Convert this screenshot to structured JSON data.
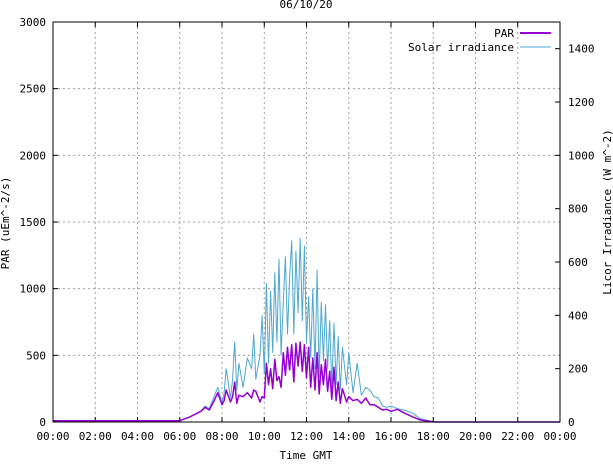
{
  "chart_data": {
    "type": "line",
    "title": "06/10/20",
    "xlabel": "Time GMT",
    "ylabel": "PAR (uEm^-2/s)",
    "y2label": "Licor Irradiance (W m^-2)",
    "grid": true,
    "legend_position": "top-right",
    "xlim": [
      0,
      24
    ],
    "ylim": [
      0,
      3000
    ],
    "y2lim": [
      0,
      1500
    ],
    "x_tick_labels": [
      "00:00",
      "02:00",
      "04:00",
      "06:00",
      "08:00",
      "10:00",
      "12:00",
      "14:00",
      "16:00",
      "18:00",
      "20:00",
      "22:00",
      "00:00"
    ],
    "y_tick_labels": [
      "0",
      "500",
      "1000",
      "1500",
      "2000",
      "2500",
      "3000"
    ],
    "y2_tick_labels": [
      "0",
      "200",
      "400",
      "600",
      "800",
      "1000",
      "1200",
      "1400"
    ],
    "series": [
      {
        "name": "PAR",
        "axis": "left",
        "color": "#9400d3",
        "x": [
          0,
          6.0,
          6.5,
          7.0,
          7.2,
          7.4,
          7.6,
          7.8,
          8.0,
          8.1,
          8.2,
          8.4,
          8.5,
          8.6,
          8.7,
          8.8,
          9.0,
          9.2,
          9.4,
          9.5,
          9.6,
          9.8,
          9.9,
          10.0,
          10.1,
          10.2,
          10.3,
          10.4,
          10.5,
          10.6,
          10.7,
          10.8,
          10.9,
          11.0,
          11.1,
          11.2,
          11.3,
          11.4,
          11.5,
          11.6,
          11.7,
          11.8,
          11.9,
          12.0,
          12.1,
          12.2,
          12.3,
          12.4,
          12.5,
          12.6,
          12.7,
          12.8,
          12.9,
          13.0,
          13.1,
          13.2,
          13.3,
          13.4,
          13.5,
          13.6,
          13.7,
          13.8,
          13.9,
          14.0,
          14.2,
          14.4,
          14.6,
          14.8,
          15.0,
          15.2,
          15.4,
          15.6,
          15.8,
          16.0,
          16.3,
          16.6,
          17.0,
          17.4,
          17.8,
          18.1,
          24
        ],
        "values": [
          10,
          10,
          40,
          80,
          110,
          90,
          150,
          220,
          130,
          160,
          240,
          150,
          190,
          300,
          140,
          200,
          190,
          220,
          180,
          240,
          230,
          150,
          190,
          180,
          440,
          280,
          400,
          250,
          470,
          310,
          340,
          260,
          520,
          350,
          560,
          390,
          580,
          300,
          590,
          420,
          600,
          380,
          580,
          330,
          560,
          260,
          480,
          240,
          520,
          210,
          430,
          280,
          470,
          230,
          380,
          170,
          410,
          160,
          300,
          140,
          250,
          200,
          150,
          190,
          160,
          170,
          140,
          180,
          130,
          130,
          110,
          90,
          95,
          80,
          95,
          70,
          40,
          15,
          5,
          0,
          0
        ]
      },
      {
        "name": "Solar irradiance",
        "axis": "right",
        "color": "#4fa8d0",
        "x": [
          0,
          6.0,
          6.5,
          7.0,
          7.2,
          7.4,
          7.6,
          7.8,
          8.0,
          8.1,
          8.2,
          8.4,
          8.5,
          8.6,
          8.7,
          8.8,
          9.0,
          9.2,
          9.4,
          9.5,
          9.6,
          9.8,
          9.9,
          10.0,
          10.1,
          10.2,
          10.3,
          10.4,
          10.5,
          10.6,
          10.7,
          10.8,
          10.9,
          11.0,
          11.1,
          11.2,
          11.3,
          11.4,
          11.5,
          11.6,
          11.7,
          11.8,
          11.9,
          12.0,
          12.1,
          12.2,
          12.3,
          12.4,
          12.5,
          12.6,
          12.7,
          12.8,
          12.9,
          13.0,
          13.1,
          13.2,
          13.3,
          13.4,
          13.5,
          13.6,
          13.7,
          13.8,
          13.9,
          14.0,
          14.2,
          14.4,
          14.6,
          14.8,
          15.0,
          15.2,
          15.4,
          15.6,
          15.8,
          16.0,
          16.3,
          16.6,
          17.0,
          17.4,
          17.8,
          18.1,
          24
        ],
        "values": [
          5,
          5,
          20,
          40,
          60,
          50,
          90,
          130,
          70,
          110,
          200,
          90,
          160,
          300,
          120,
          220,
          130,
          240,
          200,
          330,
          160,
          250,
          400,
          180,
          520,
          220,
          490,
          260,
          560,
          300,
          610,
          250,
          450,
          620,
          330,
          540,
          680,
          330,
          640,
          410,
          690,
          380,
          660,
          300,
          470,
          240,
          500,
          200,
          570,
          170,
          450,
          230,
          440,
          200,
          380,
          130,
          370,
          140,
          320,
          120,
          280,
          210,
          140,
          260,
          110,
          220,
          100,
          130,
          120,
          95,
          90,
          60,
          55,
          60,
          50,
          45,
          35,
          12,
          5,
          0,
          0
        ]
      }
    ]
  }
}
